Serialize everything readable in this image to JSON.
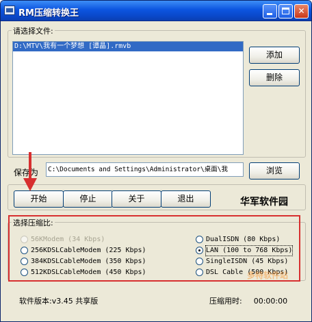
{
  "window": {
    "title": "RM压缩转换王"
  },
  "file_section": {
    "legend": "请选择文件:",
    "items": [
      "D:\\MTV\\我有一个梦想 [谭晶].rmvb"
    ],
    "add_label": "添加",
    "delete_label": "删除"
  },
  "save": {
    "label": "保存为",
    "path": "C:\\Documents and Settings\\Administrator\\桌面\\我",
    "browse_label": "浏览"
  },
  "controls": {
    "start_label": "开始",
    "stop_label": "停止",
    "about_label": "关于",
    "exit_label": "退出",
    "brand": "华军软件园"
  },
  "compression": {
    "legend": "选择压缩比:",
    "options": [
      {
        "label": "56KModem (34 Kbps)",
        "disabled": true,
        "checked": false
      },
      {
        "label": "256KDSLCableModem (225 Kbps)",
        "disabled": false,
        "checked": false
      },
      {
        "label": "384KDSLCableModem (350 Kbps)",
        "disabled": false,
        "checked": false
      },
      {
        "label": "512KDSLCableModem (450 Kbps)",
        "disabled": false,
        "checked": false
      },
      {
        "label": "DualISDN (80 Kbps)",
        "disabled": false,
        "checked": false
      },
      {
        "label": "LAN (100 to 768 Kbps)",
        "disabled": false,
        "checked": true
      },
      {
        "label": "SingleISDN (45 Kbps)",
        "disabled": false,
        "checked": false
      },
      {
        "label": "DSL Cable (500 Kbps)",
        "disabled": false,
        "checked": false
      }
    ]
  },
  "status": {
    "version": "软件版本:v3.45 共享版",
    "time_label": "压缩用时:",
    "time_value": "00:00:00"
  },
  "watermark": "多特软件站",
  "colors": {
    "title_blue": "#0c55e0",
    "highlight_red": "#d72f2f",
    "selection_blue": "#316ac5"
  }
}
